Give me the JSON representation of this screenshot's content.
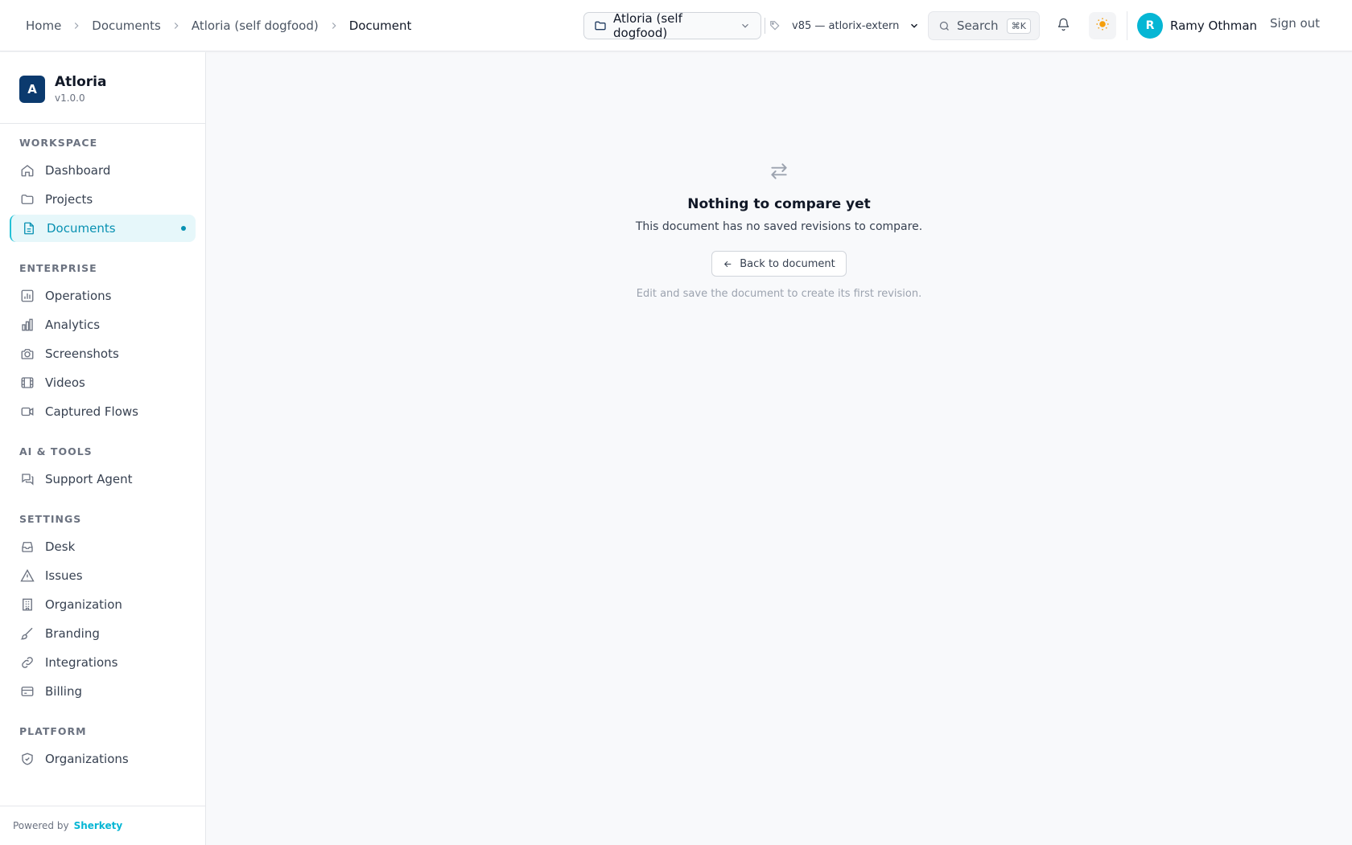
{
  "breadcrumb": {
    "items": [
      "Home",
      "Documents",
      "Atloria (self dogfood)",
      "Document"
    ]
  },
  "header": {
    "project_select": "Atloria (self dogfood)",
    "version_select": "v85 — atlorix-extern",
    "search_label": "Search",
    "search_shortcut": "⌘K",
    "user_initial": "R",
    "user_name": "Ramy Othman",
    "sign_out": "Sign out"
  },
  "sidebar": {
    "brand_initial": "A",
    "brand_name": "Atloria",
    "brand_version": "v1.0.0",
    "sections": {
      "workspace": "WORKSPACE",
      "enterprise": "ENTERPRISE",
      "ai_tools": "AI & TOOLS",
      "settings": "SETTINGS",
      "platform": "PLATFORM"
    },
    "items": {
      "dashboard": "Dashboard",
      "projects": "Projects",
      "documents": "Documents",
      "operations": "Operations",
      "analytics": "Analytics",
      "screenshots": "Screenshots",
      "videos": "Videos",
      "captured_flows": "Captured Flows",
      "support_agent": "Support Agent",
      "desk": "Desk",
      "issues": "Issues",
      "organization": "Organization",
      "branding": "Branding",
      "integrations": "Integrations",
      "billing": "Billing",
      "organizations": "Organizations"
    },
    "footer_prefix": "Powered by",
    "footer_brand": "Sherkety"
  },
  "main": {
    "empty_title": "Nothing to compare yet",
    "empty_description": "This document has no saved revisions to compare.",
    "back_button": "Back to document",
    "hint": "Edit and save the document to create its first revision."
  },
  "colors": {
    "accent": "#06b6d4",
    "brand_logo": "#0b3a6e",
    "theme_icon": "#f59e0b"
  }
}
